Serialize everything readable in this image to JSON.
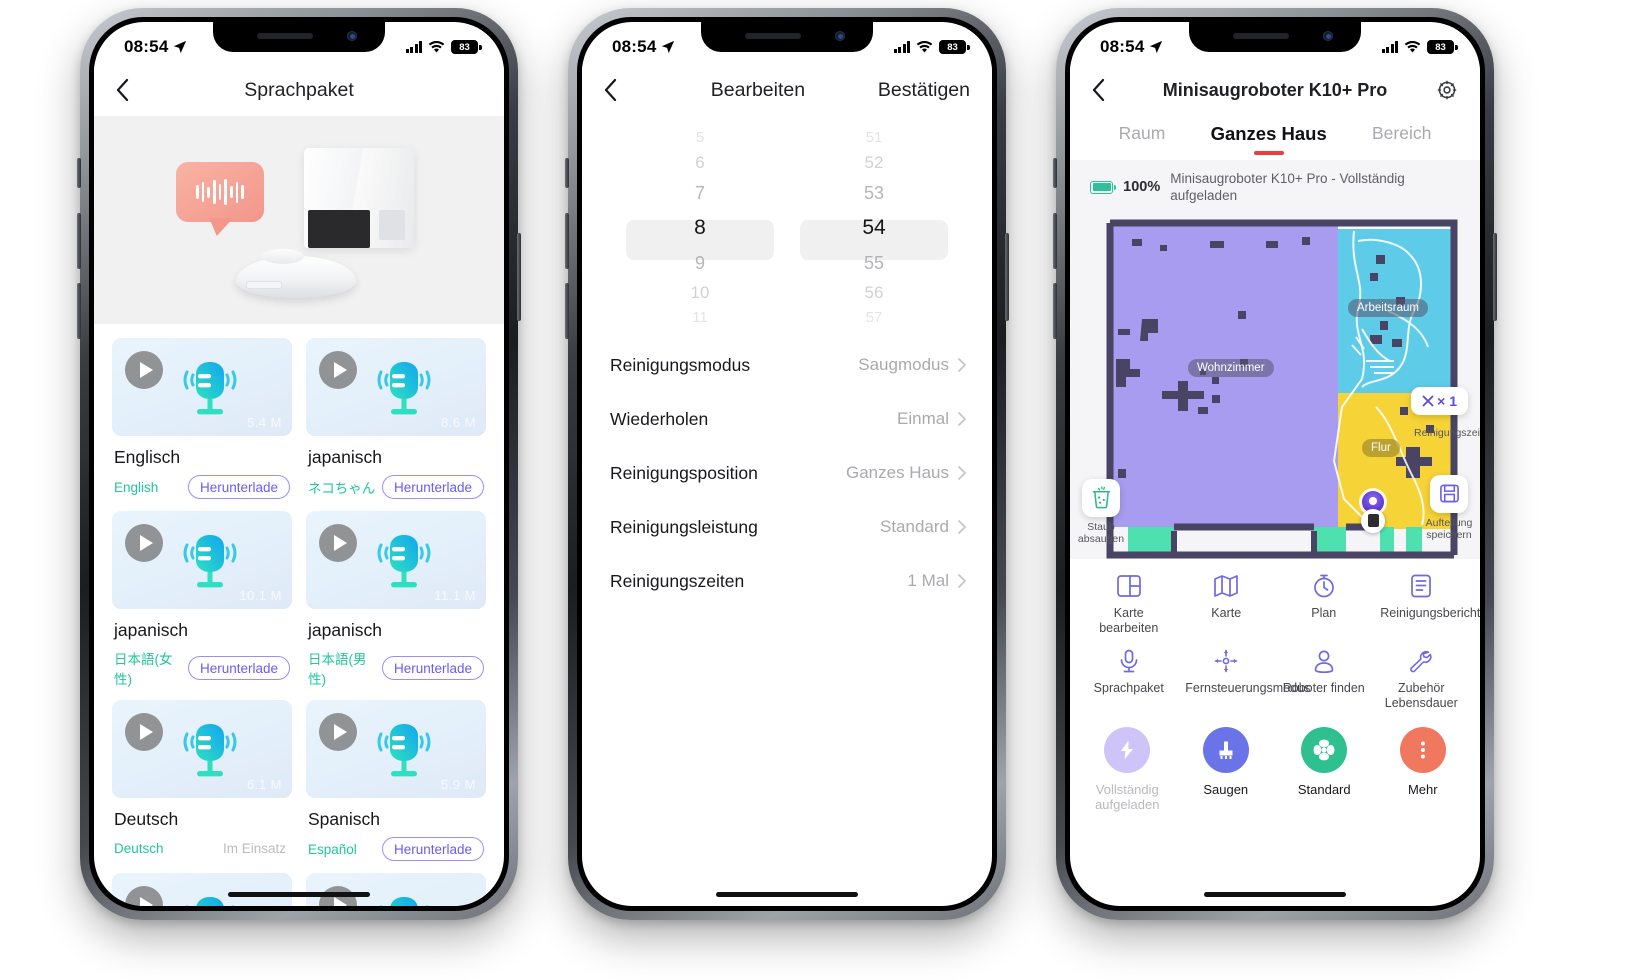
{
  "status_bar": {
    "time": "08:54",
    "battery": "83"
  },
  "phone1": {
    "nav": {
      "back_icon": "chevron-left-icon",
      "title": "Sprachpaket"
    },
    "hero": {
      "art": "robot-vacuum-with-voice-bubble"
    },
    "voice_packs": [
      {
        "name": "Englisch",
        "sub": "English",
        "size": "5.4 M",
        "action": "Herunterlade",
        "state": "download"
      },
      {
        "name": "japanisch",
        "sub": "ネコちゃん",
        "size": "8.6 M",
        "action": "Herunterlade",
        "state": "download"
      },
      {
        "name": "japanisch",
        "sub": "日本語(女性)",
        "size": "10.1 M",
        "action": "Herunterlade",
        "state": "download"
      },
      {
        "name": "japanisch",
        "sub": "日本語(男性)",
        "size": "11.1 M",
        "action": "Herunterlade",
        "state": "download"
      },
      {
        "name": "Deutsch",
        "sub": "Deutsch",
        "size": "6.1 M",
        "action": "Im Einsatz",
        "state": "in-use"
      },
      {
        "name": "Spanisch",
        "sub": "Español",
        "size": "5.9 M",
        "action": "Herunterlade",
        "state": "download"
      },
      {
        "name": "",
        "sub": "",
        "size": "",
        "action": "",
        "state": "partial"
      },
      {
        "name": "",
        "sub": "",
        "size": "",
        "action": "",
        "state": "partial"
      }
    ]
  },
  "phone2": {
    "nav": {
      "back_icon": "chevron-left-icon",
      "title": "Bearbeiten",
      "action": "Bestätigen"
    },
    "picker": {
      "hours": [
        "5",
        "6",
        "7",
        "8",
        "9",
        "10",
        "11"
      ],
      "hours_selected_index": 3,
      "minutes": [
        "51",
        "52",
        "53",
        "54",
        "55",
        "56",
        "57"
      ],
      "minutes_selected_index": 3
    },
    "settings": [
      {
        "label": "Reinigungsmodus",
        "value": "Saugmodus"
      },
      {
        "label": "Wiederholen",
        "value": "Einmal"
      },
      {
        "label": "Reinigungsposition",
        "value": "Ganzes Haus"
      },
      {
        "label": "Reinigungsleistung",
        "value": "Standard"
      },
      {
        "label": "Reinigungszeiten",
        "value": "1 Mal"
      }
    ]
  },
  "phone3": {
    "nav": {
      "back_icon": "chevron-left-icon",
      "title": "Minisaugroboter K10+ Pro",
      "settings_icon": "gear-icon"
    },
    "tabs": [
      {
        "label": "Raum",
        "active": false
      },
      {
        "label": "Ganzes Haus",
        "active": true
      },
      {
        "label": "Bereich",
        "active": false
      }
    ],
    "accent_color": "#ef3b3b",
    "battery": {
      "percent": "100%",
      "description": "Minisaugroboter K10+ Pro - Vollständig aufgeladen"
    },
    "map": {
      "rooms": [
        {
          "label": "Wohnzimmer",
          "color": "#a79cf0"
        },
        {
          "label": "Arbeitsraum",
          "color": "#5ecbe8"
        },
        {
          "label": "Flur",
          "color": "#f6d336"
        },
        {
          "label": "",
          "color": "#4fe0b0"
        }
      ],
      "dust_button": {
        "icon": "dustbin-icon",
        "label": "Staub absaugen"
      },
      "repeat_pill": {
        "icon": "close-icon",
        "label": "× 1"
      },
      "times_label": "Reinigungszeiten",
      "save_button": {
        "icon": "save-icon",
        "label": "Aufteilung speichern"
      }
    },
    "functions": [
      {
        "icon": "edit-map-icon",
        "label": "Karte bearbeiten"
      },
      {
        "icon": "map-icon",
        "label": "Karte"
      },
      {
        "icon": "timer-icon",
        "label": "Plan"
      },
      {
        "icon": "report-icon",
        "label": "Reinigungsbericht"
      },
      {
        "icon": "microphone-icon",
        "label": "Sprachpaket"
      },
      {
        "icon": "remote-control-icon",
        "label": "Fernsteuerungsmodus"
      },
      {
        "icon": "locate-robot-icon",
        "label": "Roboter finden"
      },
      {
        "icon": "wrench-icon",
        "label": "Zubehör Lebensdauer"
      }
    ],
    "actions": [
      {
        "icon": "bolt-icon",
        "label": "Vollständig aufgeladen",
        "color": "#cfc4f7",
        "muted": true
      },
      {
        "icon": "vacuum-icon",
        "label": "Saugen",
        "color": "#6a73e8",
        "muted": false
      },
      {
        "icon": "fan-icon",
        "label": "Standard",
        "color": "#2fc08f",
        "muted": false
      },
      {
        "icon": "more-icon",
        "label": "Mehr",
        "color": "#f0785e",
        "muted": false
      }
    ]
  }
}
